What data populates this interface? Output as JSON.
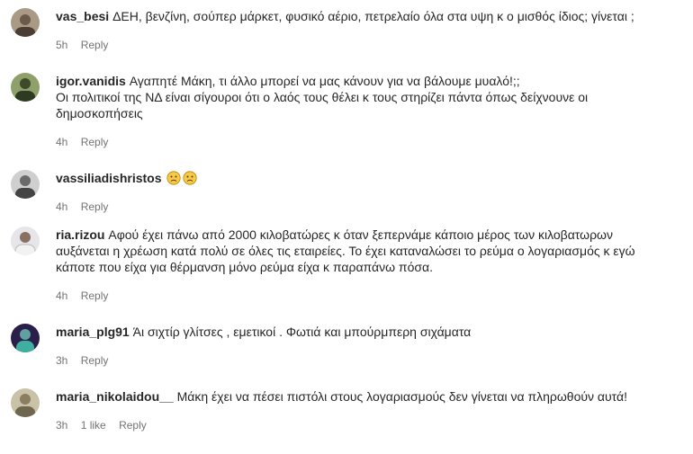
{
  "comments": [
    {
      "username": "vas_besi",
      "text": "ΔΕΗ, βενζίνη, σούπερ μάρκετ, φυσικό αέριο, πετρελαίο όλα στα υψη κ ο μισθός ίδιος; γίνεται ;",
      "time": "5h",
      "reply": "Reply",
      "avatar_color": "#6b5a4a"
    },
    {
      "username": "igor.vanidis",
      "text": "Αγαπητέ Μάκη, τι άλλο μπορεί να μας κάνουν για να βάλουμε μυαλό!;;",
      "text2": "Οι πολιτικοί της ΝΔ είναι σίγουροι ότι ο λαός τους θέλει κ τους στηρίζει πάντα όπως δείχνουνε οι",
      "text3": "δημοσκοπήσεις",
      "time": "4h",
      "reply": "Reply",
      "avatar_color": "#5d6b3a"
    },
    {
      "username": "vassiliadishristos",
      "text": "",
      "emoji": [
        "sad-face-icon",
        "sad-face-icon"
      ],
      "time": "4h",
      "reply": "Reply",
      "avatar_color": "#7a7a7a"
    },
    {
      "username": "ria.rizou",
      "text": "Αφού έχει πάνω από 2000 κιλοβατώρες κ όταν ξεπερνάμε κάποιο μέρος των κιλοβατωρων",
      "text2": "αυξάνεται η χρέωση κατά πολύ σε όλες τις εταιρείες. Το έχει καταναλώσει το ρεύμα ο λογαριασμός κ εγώ",
      "text3": "κάποτε που είχα για θέρμανση μόνο ρεύμα είχα κ παραπάνω πόσα.",
      "time": "4h",
      "reply": "Reply",
      "avatar_color": "#b8b8c0"
    },
    {
      "username": "maria_plg91",
      "text": "Άι σιχτίρ γλίτσες , εμετικοί . Φωτιά και μπούρμπερη σιχάματα",
      "time": "3h",
      "reply": "Reply",
      "avatar_color": "#3a2a5a"
    },
    {
      "username": "maria_nikolaidou__",
      "text": "Μάκη έχει να πέσει πιστόλι στους λογαριασμούς δεν γίνεται να πληρωθούν αυτά!",
      "time": "3h",
      "likes": "1 like",
      "reply": "Reply",
      "avatar_color": "#8a8670"
    }
  ]
}
